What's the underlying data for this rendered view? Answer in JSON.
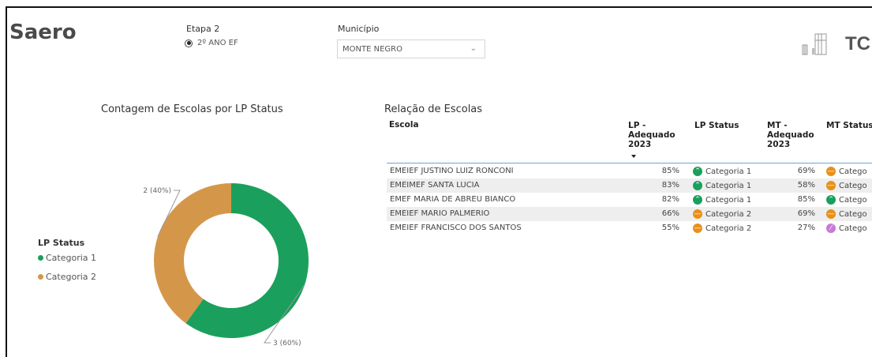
{
  "app": {
    "title": "Saero"
  },
  "filters": {
    "etapa": {
      "title": "Etapa 2",
      "option": "2º ANO EF"
    },
    "municipio": {
      "title": "Município",
      "value": "MONTE NEGRO"
    }
  },
  "logo": {
    "text": "TC"
  },
  "chart": {
    "title": "Contagem de Escolas por LP Status",
    "legend_title": "LP Status",
    "colors": {
      "Categoria 1": "#1aa05c",
      "Categoria 2": "#d4974a"
    }
  },
  "chart_data": {
    "type": "pie",
    "title": "Contagem de Escolas por LP Status",
    "categories": [
      "Categoria 1",
      "Categoria 2"
    ],
    "values": [
      3,
      2
    ],
    "data_labels": [
      "3 (60%)",
      "2 (40%)"
    ],
    "legend": "left",
    "donut": true
  },
  "table": {
    "title": "Relação de Escolas",
    "headers": {
      "escola": "Escola",
      "lp_adequado": [
        "LP -",
        "Adequado",
        "2023"
      ],
      "lp_status": "LP Status",
      "mt_adequado": [
        "MT -",
        "Adequado",
        "2023"
      ],
      "mt_status": "MT Status"
    },
    "rows": [
      {
        "escola": "EMEIEF JUSTINO LUIZ RONCONI",
        "lp": "85%",
        "lp_status": "Categoria 1",
        "lp_icon": "up",
        "mt": "69%",
        "mt_status": "Catego",
        "mt_icon": "mid"
      },
      {
        "escola": "EMEIMEF SANTA LUCIA",
        "lp": "83%",
        "lp_status": "Categoria 1",
        "lp_icon": "up",
        "mt": "58%",
        "mt_status": "Catego",
        "mt_icon": "mid"
      },
      {
        "escola": "EMEF MARIA DE ABREU BIANCO",
        "lp": "82%",
        "lp_status": "Categoria 1",
        "lp_icon": "up",
        "mt": "85%",
        "mt_status": "Catego",
        "mt_icon": "up"
      },
      {
        "escola": "EMEIEF MARIO PALMERIO",
        "lp": "66%",
        "lp_status": "Categoria 2",
        "lp_icon": "mid",
        "mt": "69%",
        "mt_status": "Catego",
        "mt_icon": "mid"
      },
      {
        "escola": "EMEIEF FRANCISCO DOS SANTOS",
        "lp": "55%",
        "lp_status": "Categoria 2",
        "lp_icon": "mid",
        "mt": "27%",
        "mt_status": "Catego",
        "mt_icon": "low"
      }
    ]
  },
  "icon_colors": {
    "up": "#1aa05c",
    "mid": "#e8901a",
    "low": "#c77ad6"
  }
}
